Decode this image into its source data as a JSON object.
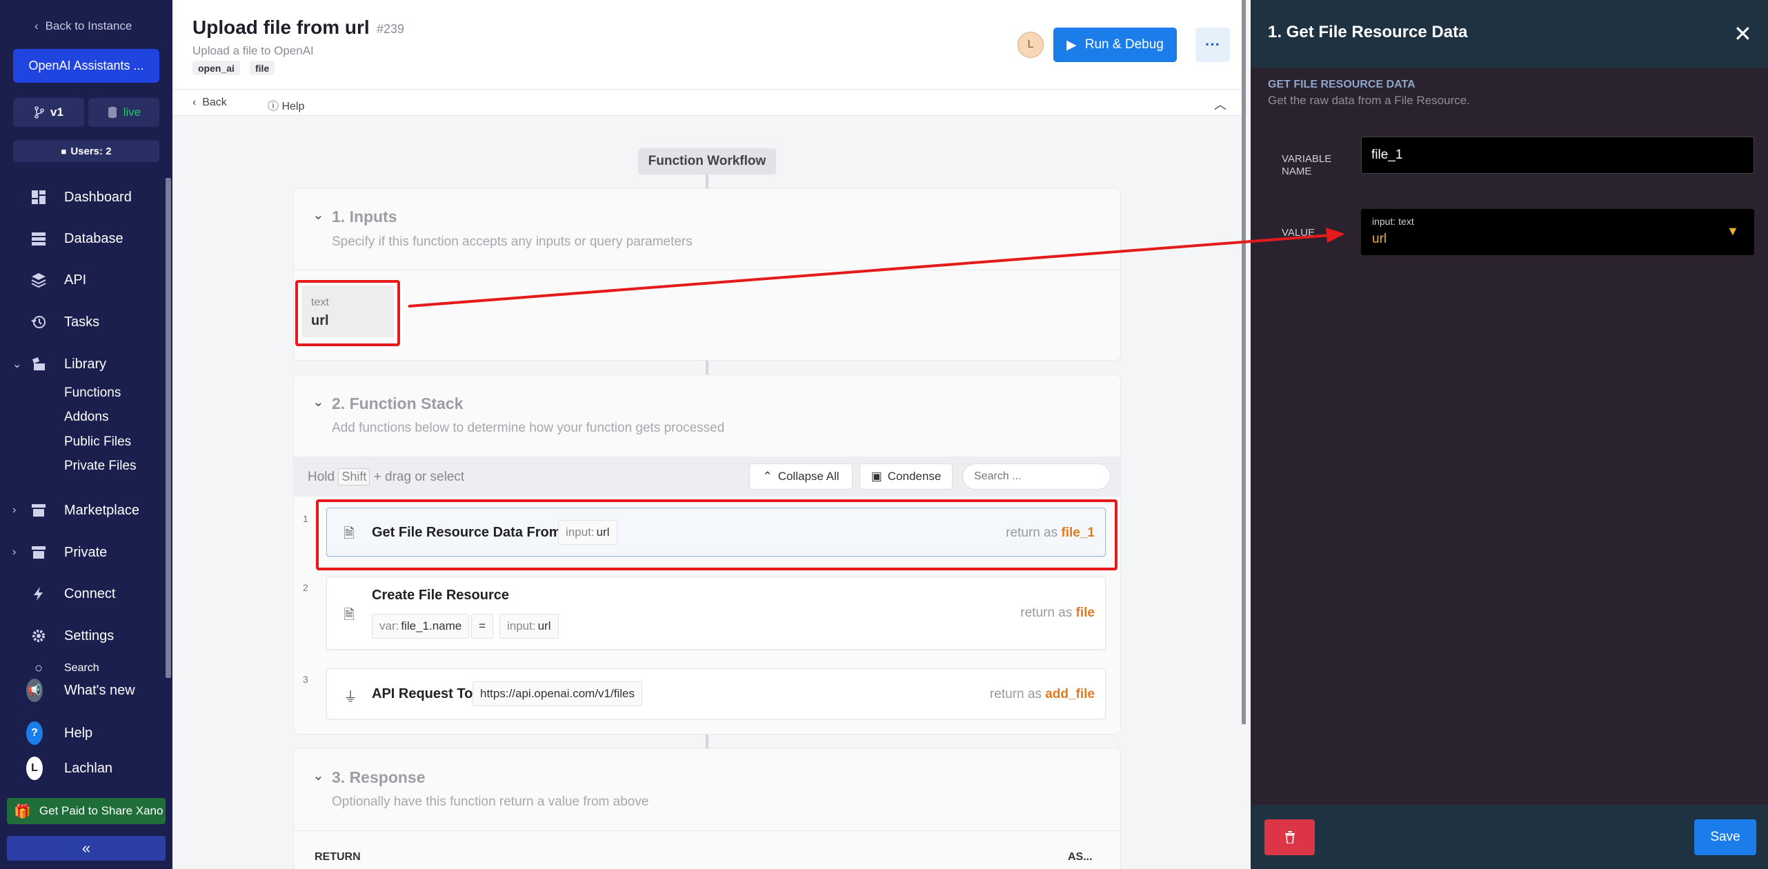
{
  "sidebar": {
    "back_label": "Back to Instance",
    "instance_name": "OpenAI Assistants ...",
    "branch": "v1",
    "environment": "live",
    "users": "Users: 2",
    "nav": [
      {
        "label": "Dashboard",
        "icon": "dashboard-icon"
      },
      {
        "label": "Database",
        "icon": "database-icon"
      },
      {
        "label": "API",
        "icon": "api-icon"
      },
      {
        "label": "Tasks",
        "icon": "tasks-icon"
      },
      {
        "label": "Library",
        "icon": "library-icon"
      },
      {
        "label": "Marketplace",
        "icon": "marketplace-icon"
      },
      {
        "label": "Private",
        "icon": "private-icon"
      },
      {
        "label": "Connect",
        "icon": "connect-icon"
      },
      {
        "label": "Settings",
        "icon": "settings-icon"
      },
      {
        "label": "Search",
        "icon": "search-icon"
      }
    ],
    "library_items": [
      "Functions",
      "Addons",
      "Public Files",
      "Private Files"
    ],
    "whats_new": "What's new",
    "help": "Help",
    "user_name": "Lachlan",
    "user_initial": "L",
    "promo": "Get Paid to Share Xano",
    "collapse_glyph": "«"
  },
  "header": {
    "title": "Upload file from url",
    "id": "#239",
    "subtitle": "Upload a file to OpenAI",
    "tags": [
      "open_ai",
      "file"
    ],
    "user_initial": "L",
    "run_label": "Run & Debug",
    "more_glyph": "···"
  },
  "subbar": {
    "back_label": "Back",
    "help_label": "Help"
  },
  "workflow": {
    "label": "Function Workflow",
    "inputs": {
      "title": "1. Inputs",
      "description": "Specify if this function accepts any inputs or query parameters",
      "items": [
        {
          "type": "text",
          "name": "url"
        }
      ]
    },
    "stack": {
      "title": "2. Function Stack",
      "description": "Add functions below to determine how your function gets processed",
      "hint_prefix": "Hold",
      "hint_key": "Shift",
      "hint_suffix": "+ drag or select",
      "collapse_all": "Collapse All",
      "condense": "Condense",
      "search_placeholder": "Search ...",
      "return_as": "return as",
      "steps": [
        {
          "num": "1",
          "title": "Get File Resource Data From",
          "chips": [
            {
              "k": "input:",
              "v": "url"
            }
          ],
          "return_var": "file_1"
        },
        {
          "num": "2",
          "title": "Create File Resource",
          "chips": [
            {
              "k": "var:",
              "v": "file_1.name"
            },
            {
              "k": "",
              "v": "="
            },
            {
              "k": "input:",
              "v": "url"
            }
          ],
          "return_var": "file"
        },
        {
          "num": "3",
          "title": "API Request To",
          "chips": [
            {
              "k": "",
              "v": "https://api.openai.com/v1/files"
            }
          ],
          "return_var": "add_file"
        }
      ]
    },
    "response": {
      "title": "3. Response",
      "description": "Optionally have this function return a value from above",
      "return_label": "RETURN",
      "as_label": "AS..."
    }
  },
  "panel": {
    "title": "1. Get File Resource Data",
    "section_heading": "GET FILE RESOURCE DATA",
    "section_sub": "Get the raw data from a File Resource.",
    "variable_label_1": "VARIABLE",
    "variable_label_2": "NAME",
    "variable_value": "file_1",
    "value_label": "VALUE",
    "value_type": "input: text",
    "value_value": "url",
    "save_label": "Save"
  },
  "colors": {
    "sidebar_bg": "#1b1f4d",
    "accent_blue": "#1a7dea",
    "return_orange": "#e07a1f",
    "highlight_red": "#e51a1a",
    "panel_bg": "#2b222f",
    "value_yellow": "#f0b429"
  }
}
